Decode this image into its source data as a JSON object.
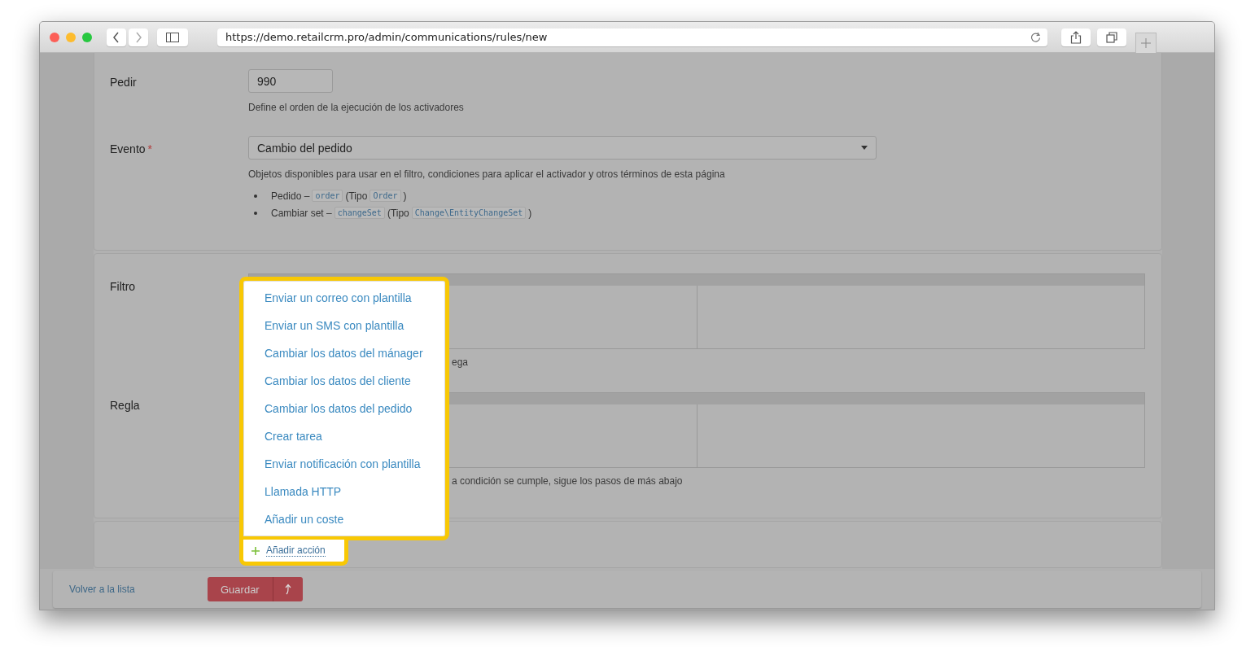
{
  "browser": {
    "url": "https://demo.retailcrm.pro/admin/communications/rules/new"
  },
  "order": {
    "label": "Pedir",
    "value": "990",
    "help": "Define el orden de la ejecución de los activadores"
  },
  "event": {
    "label": "Evento",
    "required": true,
    "required_mark": "*",
    "value": "Cambio del pedido",
    "help": "Objetos disponibles para usar en el filtro, condiciones para aplicar el activador y otros términos de esta página",
    "objects": [
      {
        "name": "Pedido –",
        "var": "order",
        "open": "(Tipo",
        "type": "Order",
        "close": ")"
      },
      {
        "name": "Cambiar set –",
        "var": "changeSet",
        "open": "(Tipo",
        "type": "Change\\EntityChangeSet",
        "close": ")"
      }
    ]
  },
  "filter": {
    "label": "Filtro",
    "help": "ega"
  },
  "rule": {
    "label": "Regla",
    "help": "a condición se cumple, sigue los pasos de más abajo"
  },
  "action_menu": {
    "items": [
      "Enviar un correo con plantilla",
      "Enviar un SMS con plantilla",
      "Cambiar los datos del mánager",
      "Cambiar los datos del cliente",
      "Cambiar los datos del pedido",
      "Crear tarea",
      "Enviar notificación con plantilla",
      "Llamada HTTP",
      "Añadir un coste"
    ],
    "add_label": "Añadir acción"
  },
  "footer": {
    "back": "Volver a la lista",
    "save": "Guardar"
  }
}
